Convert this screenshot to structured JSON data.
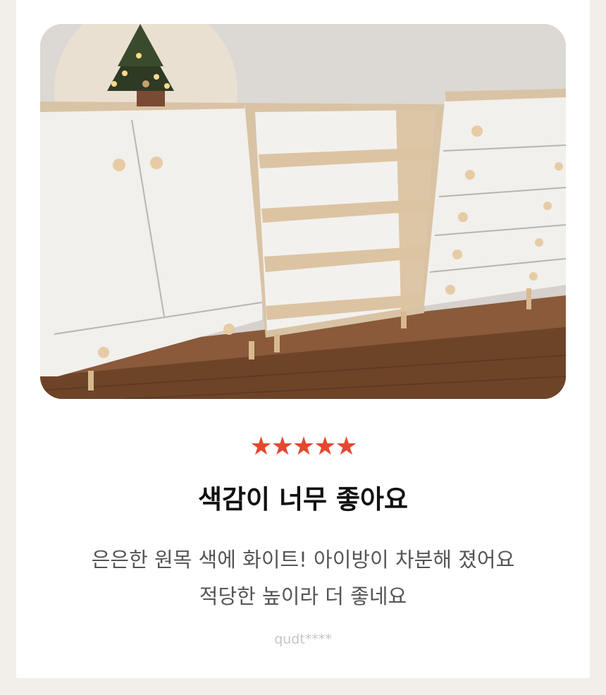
{
  "review": {
    "photo_alt": "",
    "rating": 5,
    "stars": "★★★★★",
    "star_color": "#e5482f",
    "title": "색감이 너무 좋아요",
    "body_lines": [
      "은은한 원목 색에 화이트! 아이방이 차분해 졌어요",
      "적당한 높이라 더 좋네요"
    ],
    "author": "qudt****"
  }
}
